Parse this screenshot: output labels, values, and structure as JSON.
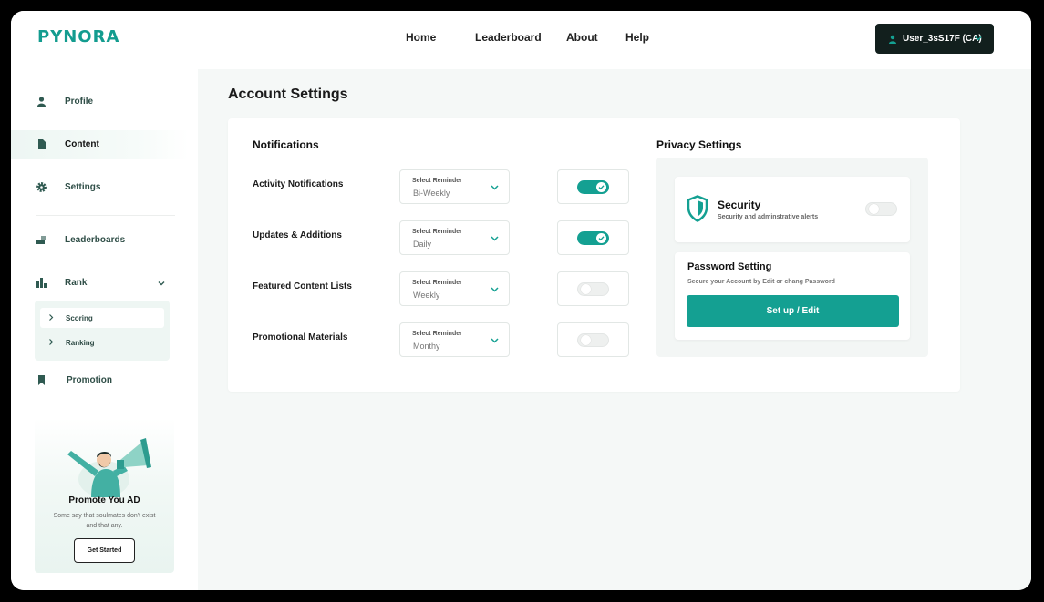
{
  "brand": {
    "logo": "PYNORA",
    "accent": "#14a092"
  },
  "nav": {
    "links": [
      "Home",
      "Leaderboard",
      "About",
      "Help"
    ]
  },
  "user": {
    "label": "User_3sS17F (CA)"
  },
  "sidebar": {
    "items": [
      "Profile",
      "Content",
      "Settings",
      "Leaderboards",
      "Rank",
      "Promotion"
    ],
    "active": "Content",
    "rank_submenu": [
      "Scoring",
      "Ranking"
    ]
  },
  "promo": {
    "title": "Promote You AD",
    "text": "Some say that soulmates don't exist and that any.",
    "button": "Get Started"
  },
  "page": {
    "title": "Account Settings"
  },
  "notifications": {
    "title": "Notifications",
    "select_label": "Select Reminder",
    "rows": [
      {
        "label": "Activity Notifications",
        "reminder": "Bi-Weekly",
        "enabled": true
      },
      {
        "label": "Updates & Additions",
        "reminder": "Daily",
        "enabled": true
      },
      {
        "label": "Featured Content Lists",
        "reminder": "Weekly",
        "enabled": false
      },
      {
        "label": "Promotional Materials",
        "reminder": "Monthy",
        "enabled": false
      }
    ]
  },
  "privacy": {
    "title": "Privacy Settings",
    "security": {
      "title": "Security",
      "desc": "Security and adminstrative alerts",
      "enabled": false
    },
    "password": {
      "title": "Password Setting",
      "desc": "Secure your Account by Edit or chang Password",
      "button": "Set up / Edit"
    }
  }
}
